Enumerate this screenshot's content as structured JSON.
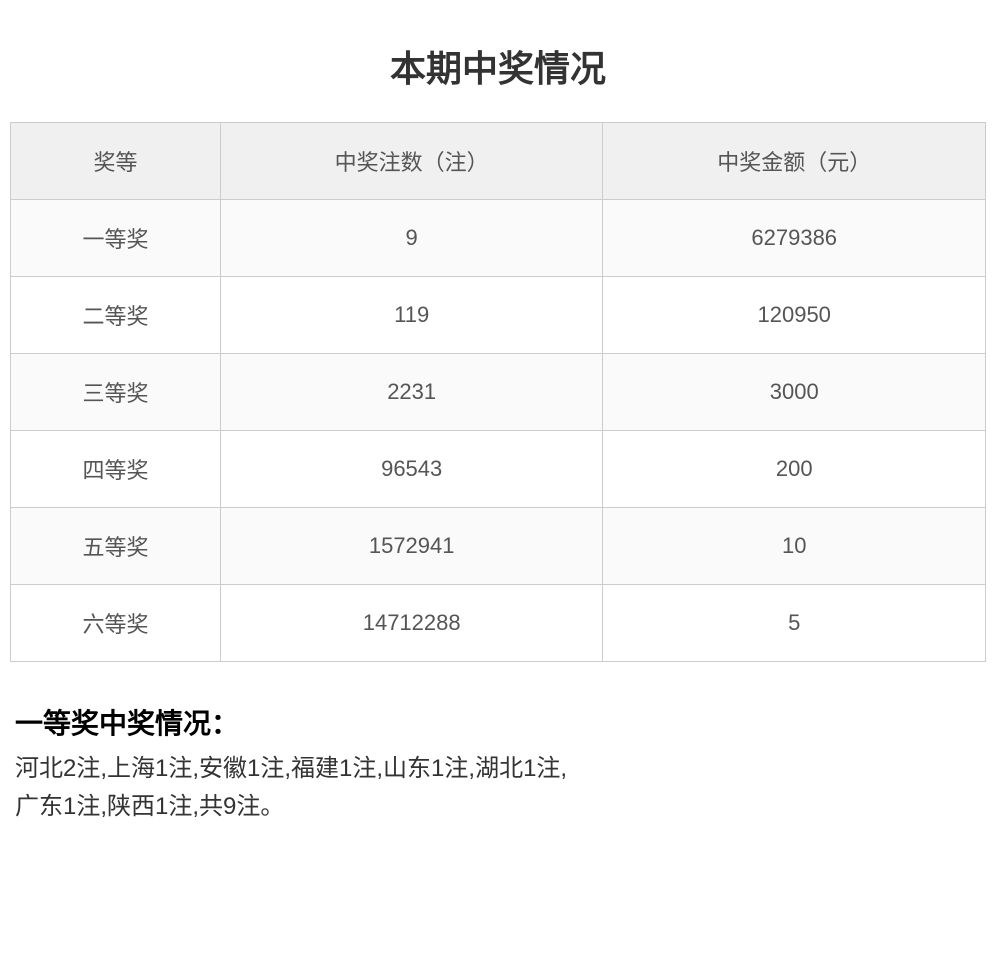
{
  "page": {
    "title": "本期中奖情况"
  },
  "table": {
    "headers": [
      "奖等",
      "中奖注数（注）",
      "中奖金额（元）"
    ],
    "rows": [
      {
        "prize_level": "一等奖",
        "count": "9",
        "amount": "6279386"
      },
      {
        "prize_level": "二等奖",
        "count": "119",
        "amount": "120950"
      },
      {
        "prize_level": "三等奖",
        "count": "2231",
        "amount": "3000"
      },
      {
        "prize_level": "四等奖",
        "count": "96543",
        "amount": "200"
      },
      {
        "prize_level": "五等奖",
        "count": "1572941",
        "amount": "10"
      },
      {
        "prize_level": "六等奖",
        "count": "14712288",
        "amount": "5"
      }
    ]
  },
  "first_prize_section": {
    "title": "一等奖中奖情况：",
    "detail_line1": "河北2注,上海1注,安徽1注,福建1注,山东1注,湖北1注,",
    "detail_line2": "广东1注,陕西1注,共9注。"
  }
}
